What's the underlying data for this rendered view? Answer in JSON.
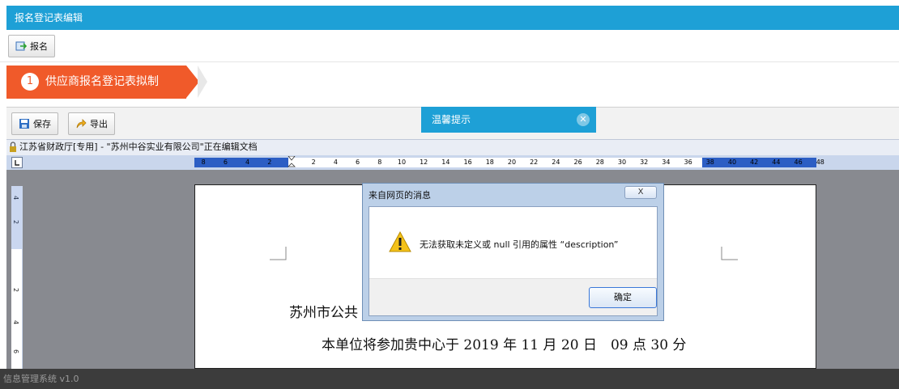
{
  "titlebar": {
    "title": "报名登记表编辑"
  },
  "toolbar": {
    "register_label": "报名"
  },
  "step": {
    "number": "1",
    "label": "供应商报名登记表拟制"
  },
  "editor": {
    "save_label": "保存",
    "export_label": "导出",
    "status_text": "江苏省财政厅[专用] - \"苏州中谷实业有限公司\"正在编辑文档",
    "ruler_left": [
      "8",
      "6",
      "4",
      "2"
    ],
    "ruler_right": [
      "2",
      "4",
      "6",
      "8",
      "10",
      "12",
      "14",
      "16",
      "18",
      "20",
      "22",
      "24",
      "26",
      "28",
      "30",
      "32",
      "34",
      "36",
      "38",
      "40",
      "42",
      "44",
      "46",
      "48"
    ],
    "ruler_vertical": [
      "4",
      "2",
      "2",
      "4",
      "6"
    ]
  },
  "document": {
    "line1": "苏州市公共",
    "line2": "本单位将参加贵中心于 2019 年 11 月 20 日　09 点 30 分"
  },
  "tip": {
    "title": "温馨提示"
  },
  "dialog": {
    "title": "来自网页的消息",
    "close_glyph": "X",
    "message": "无法获取未定义或 null 引用的属性 “description”",
    "ok_label": "确定"
  },
  "footer": {
    "text": "信息管理系统 v1.0"
  },
  "colors": {
    "accent": "#1ea0d6",
    "step": "#f05a2a",
    "footer": "#3c3c3c"
  }
}
